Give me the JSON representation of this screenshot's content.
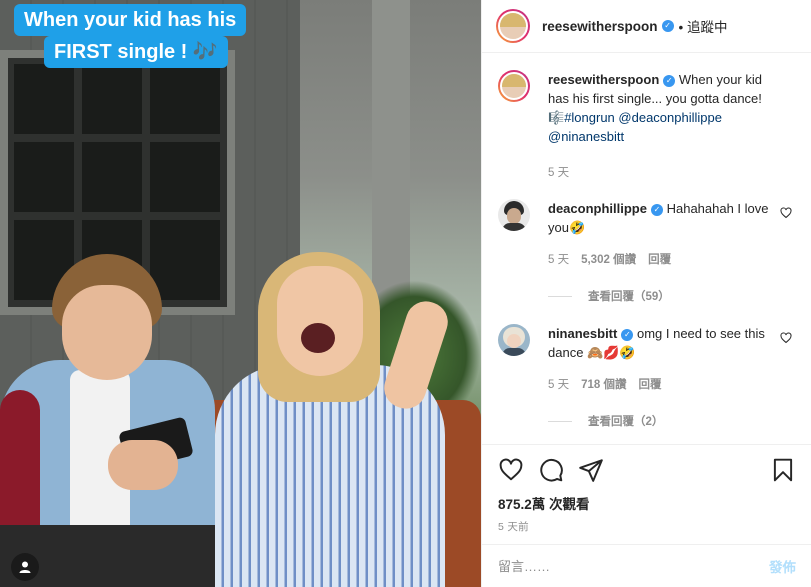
{
  "video": {
    "caption_line1": "When your kid has his",
    "caption_line2": "FIRST single !",
    "caption_note": "🎶"
  },
  "header": {
    "username": "reesewitherspoon",
    "follow_status": "• 追蹤中"
  },
  "post": {
    "username": "reesewitherspoon",
    "text": "When your kid has his first single... you gotta dance!",
    "emoji": "🎼",
    "hashtag": "#longrun",
    "mention1": "@deaconphillippe",
    "mention2": "@ninanesbitt",
    "time": "5 天"
  },
  "comments": [
    {
      "username": "deaconphillippe",
      "text": "Hahahahah I love you🤣",
      "time": "5 天",
      "likes": "5,302 個讚",
      "reply": "回覆",
      "view_replies": "查看回覆（59）"
    },
    {
      "username": "ninanesbitt",
      "text": "omg I need to see this dance 🙈💋🤣",
      "time": "5 天",
      "likes": "718 個讚",
      "reply": "回覆",
      "view_replies": "查看回覆（2）"
    }
  ],
  "actions": {
    "views_count": "875.2萬",
    "views_label": "次觀看",
    "posted_ago": "5 天前"
  },
  "composer": {
    "placeholder": "留言……",
    "post_label": "發佈"
  },
  "colors": {
    "caption_bg": "#1fa0e8",
    "verified": "#3897f0",
    "link": "#00376b",
    "post_disabled": "#b2dffc"
  }
}
